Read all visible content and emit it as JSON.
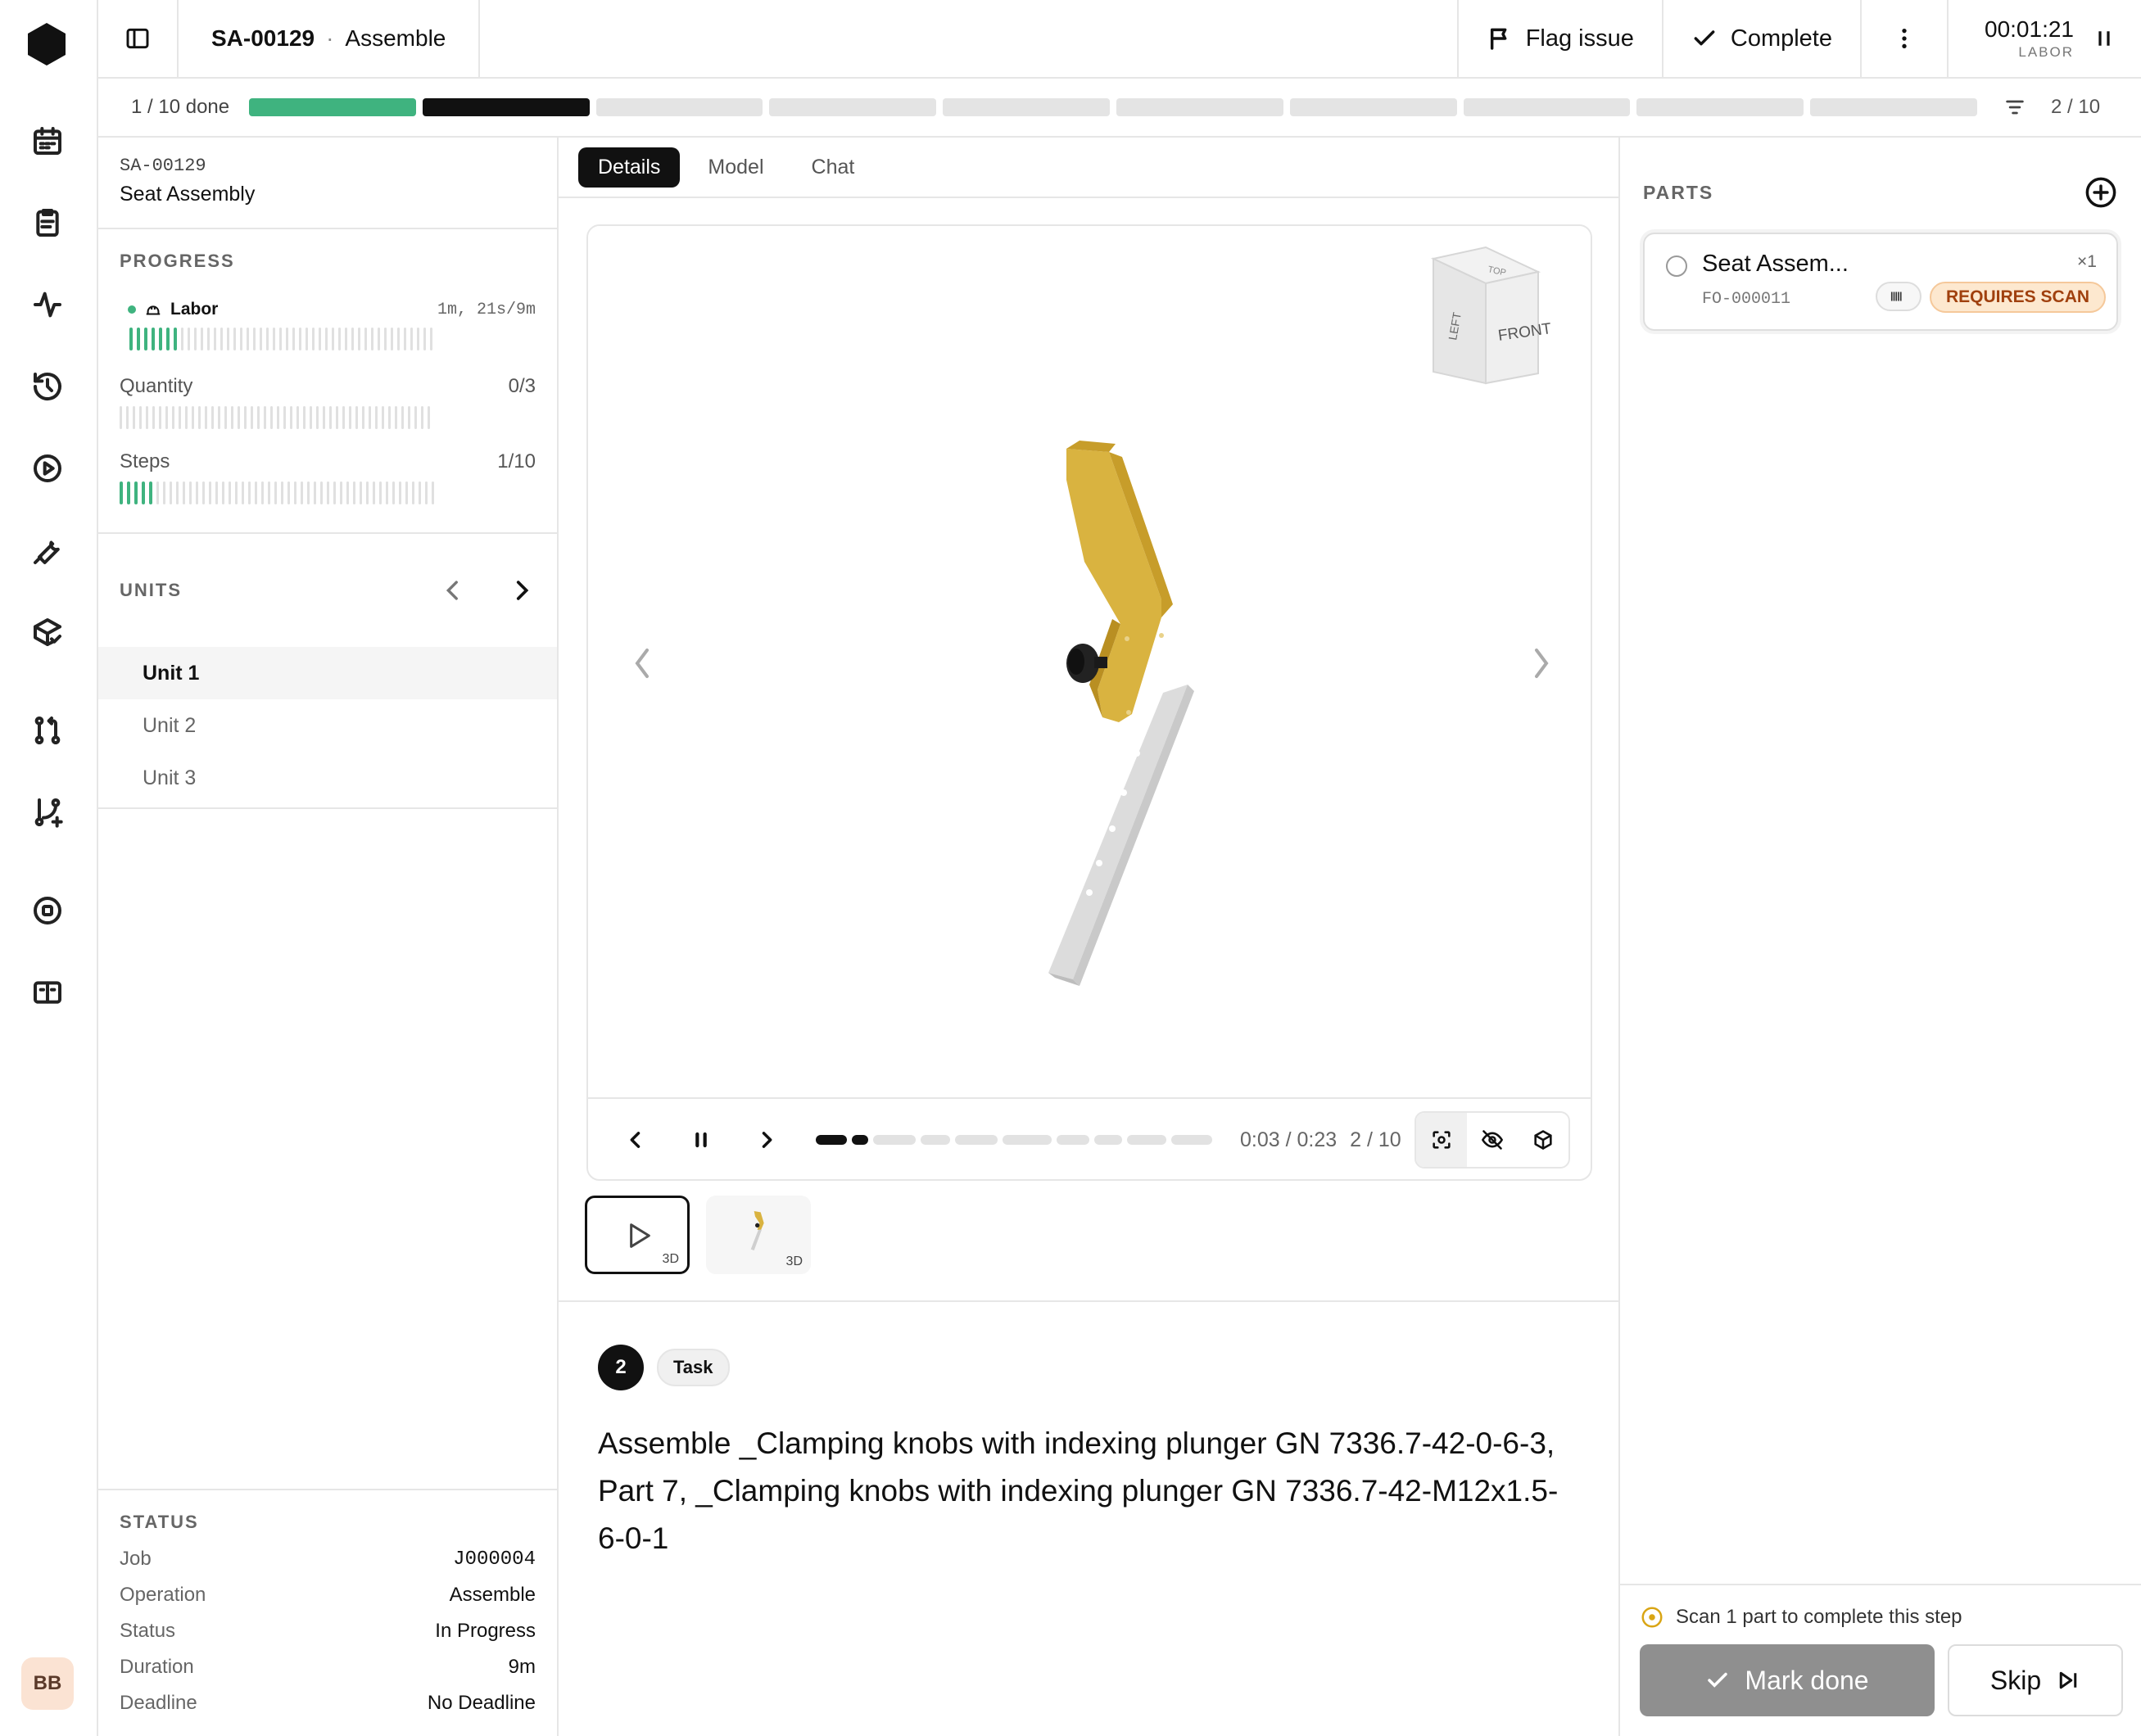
{
  "topbar": {
    "job_id": "SA-00129",
    "operation": "Assemble",
    "separator": "·",
    "flag_label": "Flag issue",
    "complete_label": "Complete",
    "timer": "00:01:21",
    "timer_label": "LABOR"
  },
  "steps": {
    "done_label": "1 / 10 done",
    "total": 10,
    "completed": 1,
    "current": 2,
    "position_label": "2 / 10"
  },
  "left": {
    "item_id": "SA-00129",
    "item_name": "Seat Assembly",
    "progress_title": "PROGRESS",
    "labor_label": "Labor",
    "labor_value": "1m, 21s/9m",
    "labor_fraction": 0.15,
    "quantity_label": "Quantity",
    "quantity_value": "0/3",
    "steps_label": "Steps",
    "steps_value": "1/10",
    "units_title": "UNITS",
    "units": [
      "Unit 1",
      "Unit 2",
      "Unit 3"
    ],
    "active_unit": 0,
    "status_title": "STATUS",
    "status": [
      {
        "k": "Job",
        "v": "J000004"
      },
      {
        "k": "Operation",
        "v": "Assemble"
      },
      {
        "k": "Status",
        "v": "In Progress"
      },
      {
        "k": "Duration",
        "v": "9m"
      },
      {
        "k": "Deadline",
        "v": "No Deadline"
      }
    ],
    "avatar": "BB"
  },
  "center": {
    "tabs": [
      "Details",
      "Model",
      "Chat"
    ],
    "active_tab": 0,
    "cube_front": "FRONT",
    "cube_left": "LEFT",
    "cube_top": "TOP",
    "playback_time": "0:03 / 0:23",
    "playback_step": "2 / 10",
    "playback_progress": 0.13,
    "thumb_badge_1": "3D",
    "thumb_badge_2": "3D",
    "step_number": "2",
    "step_tag": "Task",
    "step_text": "Assemble _Clamping knobs with indexing plunger GN 7336.7-42-0-6-3, Part 7, _Clamping knobs with indexing plunger GN 7336.7-42-M12x1.5-6-0-1"
  },
  "right": {
    "parts_title": "PARTS",
    "part_name": "Seat Assem...",
    "part_number": "FO-000011",
    "part_qty": "×1",
    "requires_scan": "REQUIRES SCAN",
    "scan_message": "Scan 1 part to complete this step",
    "mark_done": "Mark done",
    "skip": "Skip"
  },
  "colors": {
    "accent_green": "#3fb37f",
    "model_yellow": "#d9b340",
    "warning_orange": "#a0400e"
  }
}
